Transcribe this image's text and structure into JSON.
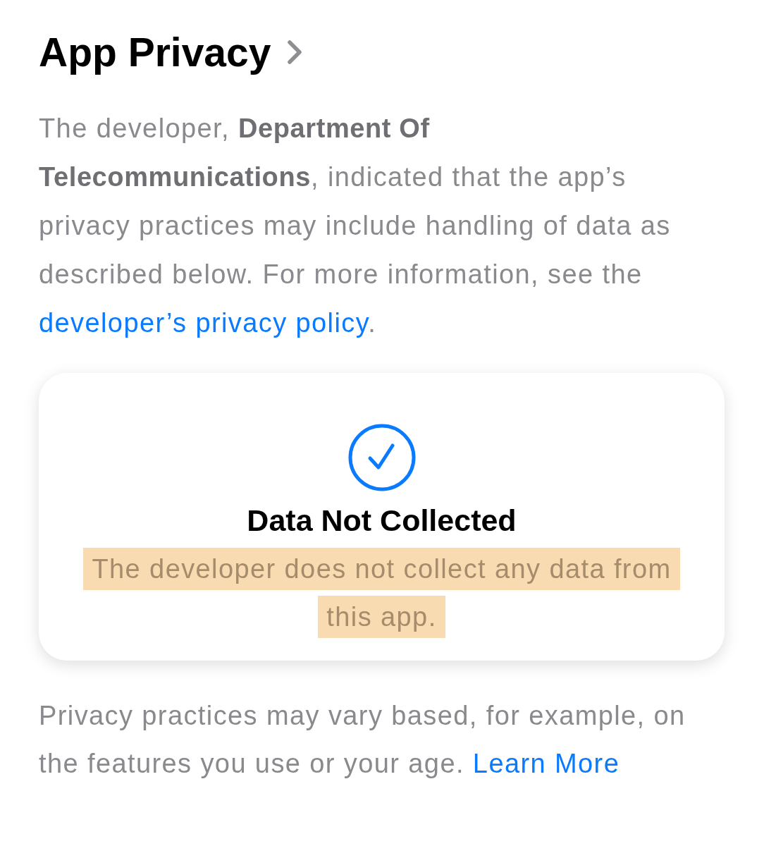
{
  "header": {
    "title": "App Privacy"
  },
  "description": {
    "text": "The developer, **Department Of Telecommunications**, indicated that the app’s privacy practices may include handling of data as described below. For more information, see the",
    "link": "developer’s privacy policy",
    "after_link": "."
  },
  "card": {
    "title": "Data Not Collected",
    "text_lines": [
      "The developer does not collect any data from",
      "this app."
    ],
    "highlighted": true
  },
  "footer": {
    "text": "Privacy practices may vary based, for example, on the features you use or your age.",
    "link": "Learn More"
  }
}
